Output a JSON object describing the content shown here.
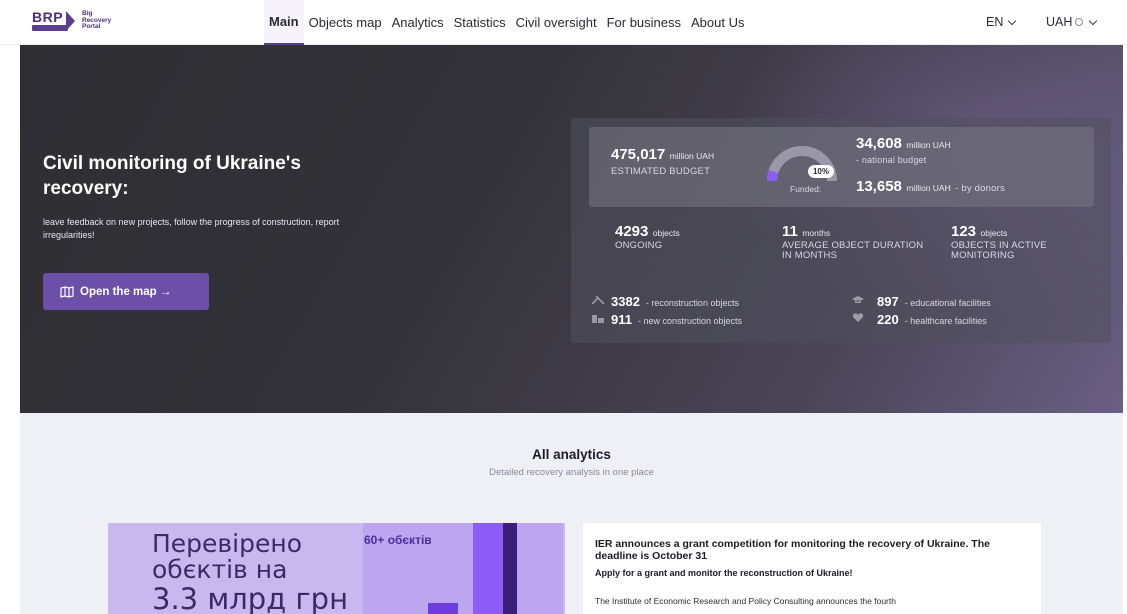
{
  "header": {
    "logo": {
      "mark": "BRP",
      "line1": "Big",
      "line2": "Recovery",
      "line3": "Portal"
    },
    "nav": [
      {
        "label": "Main",
        "active": true
      },
      {
        "label": "Objects map"
      },
      {
        "label": "Analytics"
      },
      {
        "label": "Statistics"
      },
      {
        "label": "Civil oversight"
      },
      {
        "label": "For business"
      },
      {
        "label": "About Us"
      }
    ],
    "language": "EN",
    "currency": "UAH"
  },
  "hero": {
    "title": "Civil monitoring of Ukraine's recovery:",
    "subtitle": "leave feedback on new projects, follow the progress of construction, report irregularities!",
    "open_map_label": "Open the map →",
    "budget": {
      "estimated_value": "475,017",
      "estimated_unit": "million UAH",
      "estimated_caption": "ESTIMATED BUDGET",
      "funded_percent": "10%",
      "funded_fraction": 0.1,
      "funded_label": "Funded:",
      "national_value": "34,608",
      "national_unit": "million UAH",
      "national_caption": "- national budget",
      "donors_value": "13,658",
      "donors_unit": "million UAH",
      "donors_caption": "- by donors"
    },
    "stats": [
      {
        "value": "4293",
        "unit": "objects",
        "caption": "ONGOING"
      },
      {
        "value": "11",
        "unit": "months",
        "caption": "AVERAGE OBJECT DURATION IN MONTHS"
      },
      {
        "value": "123",
        "unit": "objects",
        "caption": "OBJECTS IN ACTIVE MONITORING"
      }
    ],
    "categories": [
      {
        "value": "3382",
        "label": "- reconstruction objects",
        "icon": "tools-icon"
      },
      {
        "value": "911",
        "label": "- new construction objects",
        "icon": "building-icon"
      },
      {
        "value": "897",
        "label": "- educational facilities",
        "icon": "graduation-cap-icon"
      },
      {
        "value": "220",
        "label": "- healthcare facilities",
        "icon": "heart-icon"
      }
    ]
  },
  "analytics": {
    "title": "All analytics",
    "subtitle": "Detailed recovery analysis in one place",
    "promo": {
      "line1": "Перевірено",
      "line2": "обєктів на",
      "line3": "3.3 млрд грн",
      "badge": "60+ обєктів"
    },
    "news": {
      "title": "IER announces a grant competition for monitoring the recovery of Ukraine. The deadline is October 31",
      "lead": "Apply for a grant and monitor the reconstruction of Ukraine!",
      "body": "The Institute of Economic Research and Policy Consulting announces the fourth"
    }
  },
  "colors": {
    "accent": "#6c4fa8",
    "brand": "#4a2f7a",
    "hero_bg": "#2e2e33",
    "analytics_bg": "#eef0f6"
  }
}
